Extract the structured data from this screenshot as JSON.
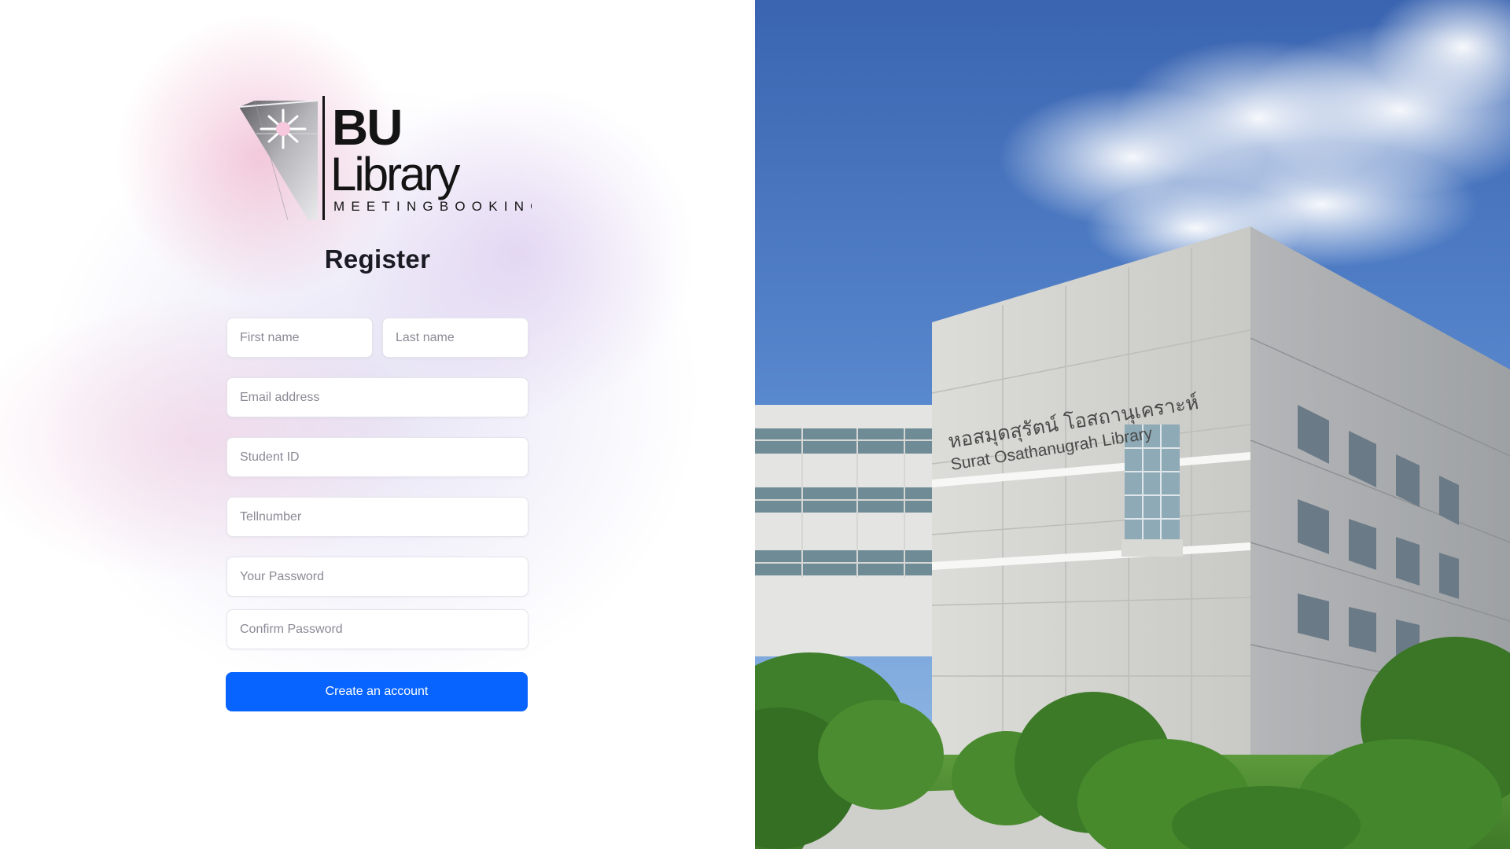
{
  "logo": {
    "line1": "BU",
    "line2": "Library",
    "tagline": "MEETINGBOOKING"
  },
  "page_title": "Register",
  "form": {
    "first_name": {
      "placeholder": "First name",
      "value": ""
    },
    "last_name": {
      "placeholder": "Last name",
      "value": ""
    },
    "email": {
      "placeholder": "Email address",
      "value": ""
    },
    "student_id": {
      "placeholder": "Student ID",
      "value": ""
    },
    "tel": {
      "placeholder": "Tellnumber",
      "value": ""
    },
    "password": {
      "placeholder": "Your Password",
      "value": ""
    },
    "confirm_password": {
      "placeholder": "Confirm Password",
      "value": ""
    },
    "submit_label": "Create an account"
  },
  "photo": {
    "sign_thai": "หอสมุดสุรัตน์ โอสถานุเคราะห์",
    "sign_english": "Surat Osathanugrah Library"
  },
  "colors": {
    "primary_button": "#0764ff",
    "title_text": "#1b1b24"
  }
}
